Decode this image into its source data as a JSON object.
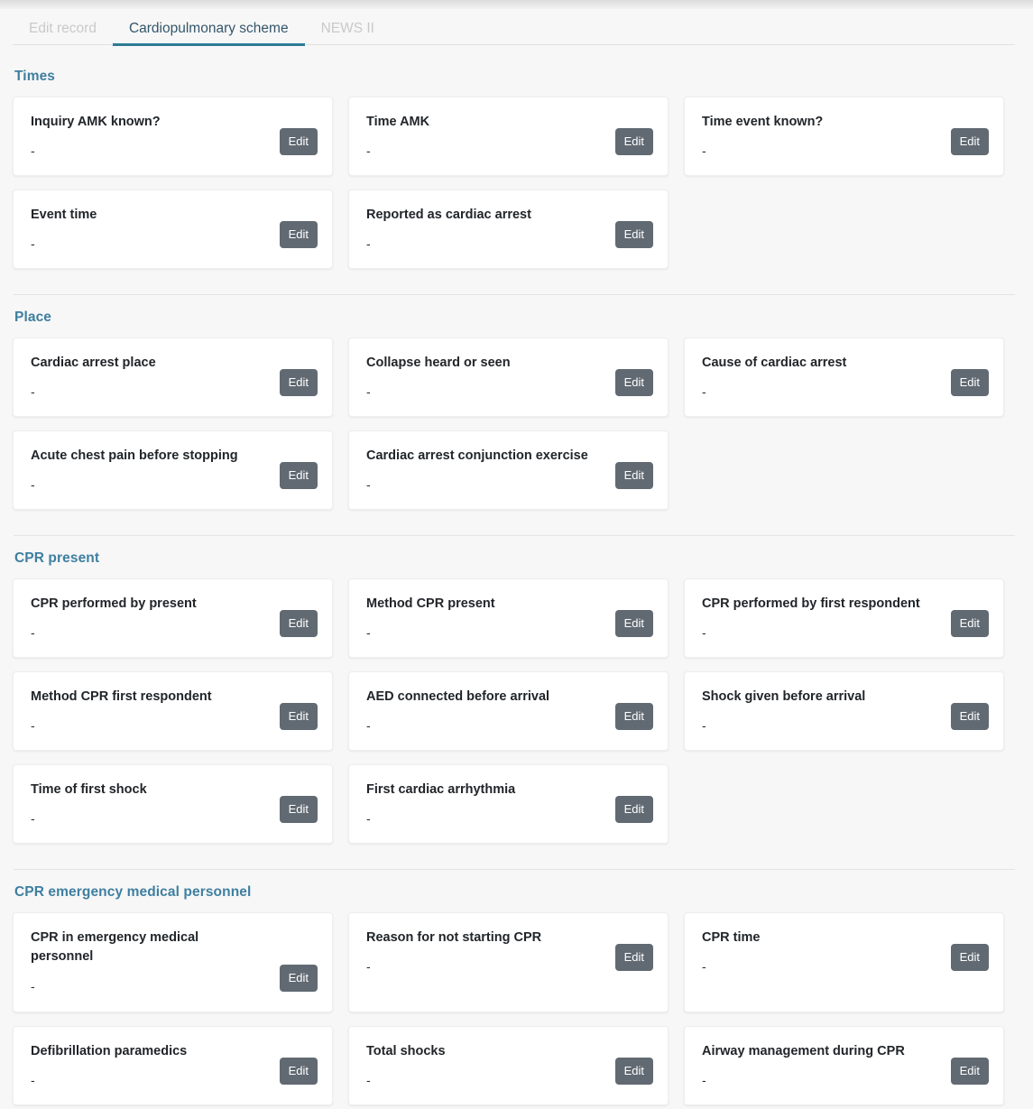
{
  "edit_label": "Edit",
  "empty_value": "-",
  "colors": {
    "accent": "#2e7b95",
    "section_header": "#3e7fa0",
    "button": "#616a72",
    "background": "#f7f7f7",
    "card": "#ffffff"
  },
  "tabs": [
    {
      "label": "Edit record",
      "active": false
    },
    {
      "label": "Cardiopulmonary scheme",
      "active": true
    },
    {
      "label": "NEWS II",
      "active": false
    }
  ],
  "sections": [
    {
      "title": "Times",
      "cards": [
        {
          "title": "Inquiry AMK known?",
          "value": "-",
          "edit": "Edit"
        },
        {
          "title": "Time AMK",
          "value": "-",
          "edit": "Edit"
        },
        {
          "title": "Time event known?",
          "value": "-",
          "edit": "Edit"
        },
        {
          "title": "Event time",
          "value": "-",
          "edit": "Edit"
        },
        {
          "title": "Reported as cardiac arrest",
          "value": "-",
          "edit": "Edit"
        }
      ]
    },
    {
      "title": "Place",
      "cards": [
        {
          "title": "Cardiac arrest place",
          "value": "-",
          "edit": "Edit"
        },
        {
          "title": "Collapse heard or seen",
          "value": "-",
          "edit": "Edit"
        },
        {
          "title": "Cause of cardiac arrest",
          "value": "-",
          "edit": "Edit"
        },
        {
          "title": "Acute chest pain before stopping",
          "value": "-",
          "edit": "Edit"
        },
        {
          "title": "Cardiac arrest conjunction exercise",
          "value": "-",
          "edit": "Edit"
        }
      ]
    },
    {
      "title": "CPR present",
      "cards": [
        {
          "title": "CPR performed by present",
          "value": "-",
          "edit": "Edit"
        },
        {
          "title": "Method CPR present",
          "value": "-",
          "edit": "Edit"
        },
        {
          "title": "CPR performed by first respondent",
          "value": "-",
          "edit": "Edit"
        },
        {
          "title": "Method CPR first respondent",
          "value": "-",
          "edit": "Edit"
        },
        {
          "title": "AED connected before arrival",
          "value": "-",
          "edit": "Edit"
        },
        {
          "title": "Shock given before arrival",
          "value": "-",
          "edit": "Edit"
        },
        {
          "title": "Time of first shock",
          "value": "-",
          "edit": "Edit"
        },
        {
          "title": "First cardiac arrhythmia",
          "value": "-",
          "edit": "Edit"
        }
      ]
    },
    {
      "title": "CPR emergency medical personnel",
      "cards": [
        {
          "title": "CPR in emergency medical personnel",
          "value": "-",
          "edit": "Edit",
          "tall": true
        },
        {
          "title": "Reason for not starting CPR",
          "value": "-",
          "edit": "Edit"
        },
        {
          "title": "CPR time",
          "value": "-",
          "edit": "Edit"
        },
        {
          "title": "Defibrillation paramedics",
          "value": "-",
          "edit": "Edit"
        },
        {
          "title": "Total shocks",
          "value": "-",
          "edit": "Edit"
        },
        {
          "title": "Airway management during CPR",
          "value": "-",
          "edit": "Edit"
        }
      ]
    }
  ]
}
